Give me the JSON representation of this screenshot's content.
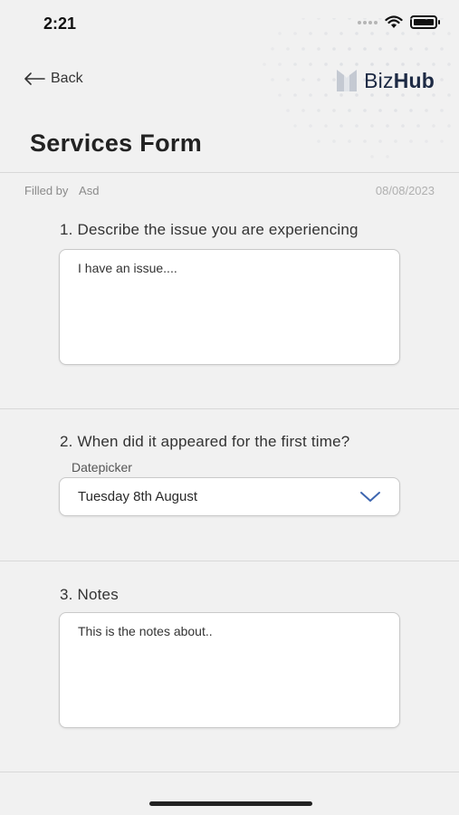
{
  "status_bar": {
    "time": "2:21"
  },
  "header": {
    "back_label": "Back",
    "logo_light": "Biz",
    "logo_bold": "Hub"
  },
  "page": {
    "title": "Services Form"
  },
  "meta": {
    "filled_by_label": "Filled by",
    "filled_by_value": "Asd",
    "date": "08/08/2023"
  },
  "questions": [
    {
      "label": "1. Describe the issue you are experiencing",
      "value": "I have an issue...."
    },
    {
      "label": "2. When did it appeared for the first time?",
      "field_label": "Datepicker",
      "selected": "Tuesday 8th August"
    },
    {
      "label": "3. Notes",
      "value": "This is the notes about.."
    }
  ],
  "colors": {
    "accent": "#3d66b0",
    "brand": "#1d2a44",
    "background": "#f1f1f1"
  }
}
